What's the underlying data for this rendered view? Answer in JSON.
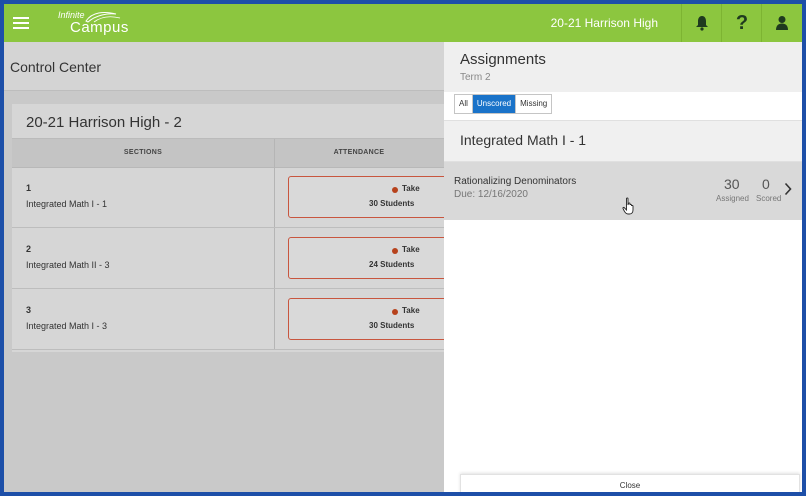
{
  "header": {
    "logo_top": "Infinite",
    "logo_bottom": "Campus",
    "school_name": "20-21 Harrison High",
    "icons": [
      "menu-icon",
      "bell-icon",
      "help-icon",
      "user-icon"
    ],
    "help_glyph": "?",
    "bar_color": "#8cc63f"
  },
  "left": {
    "page_title": "Control Center",
    "card_title": "20-21 Harrison High - 2",
    "col_sections": "SECTIONS",
    "col_attendance": "ATTENDANCE",
    "rows": [
      {
        "num": "1",
        "name": "Integrated Math I - 1",
        "take": "Take",
        "students": "30 Students"
      },
      {
        "num": "2",
        "name": "Integrated Math II - 3",
        "take": "Take",
        "students": "24 Students"
      },
      {
        "num": "3",
        "name": "Integrated Math I - 3",
        "take": "Take",
        "students": "30 Students"
      }
    ]
  },
  "right": {
    "title": "Assignments",
    "subtitle": "Term 2",
    "filters": [
      "All",
      "Unscored",
      "Missing"
    ],
    "active_filter": "Unscored",
    "course": "Integrated Math I - 1",
    "assignment": {
      "name": "Rationalizing Denominators",
      "due": "Due: 12/16/2020",
      "assigned_count": "30",
      "assigned_label": "Assigned",
      "scored_count": "0",
      "scored_label": "Scored"
    },
    "close_label": "Close"
  }
}
